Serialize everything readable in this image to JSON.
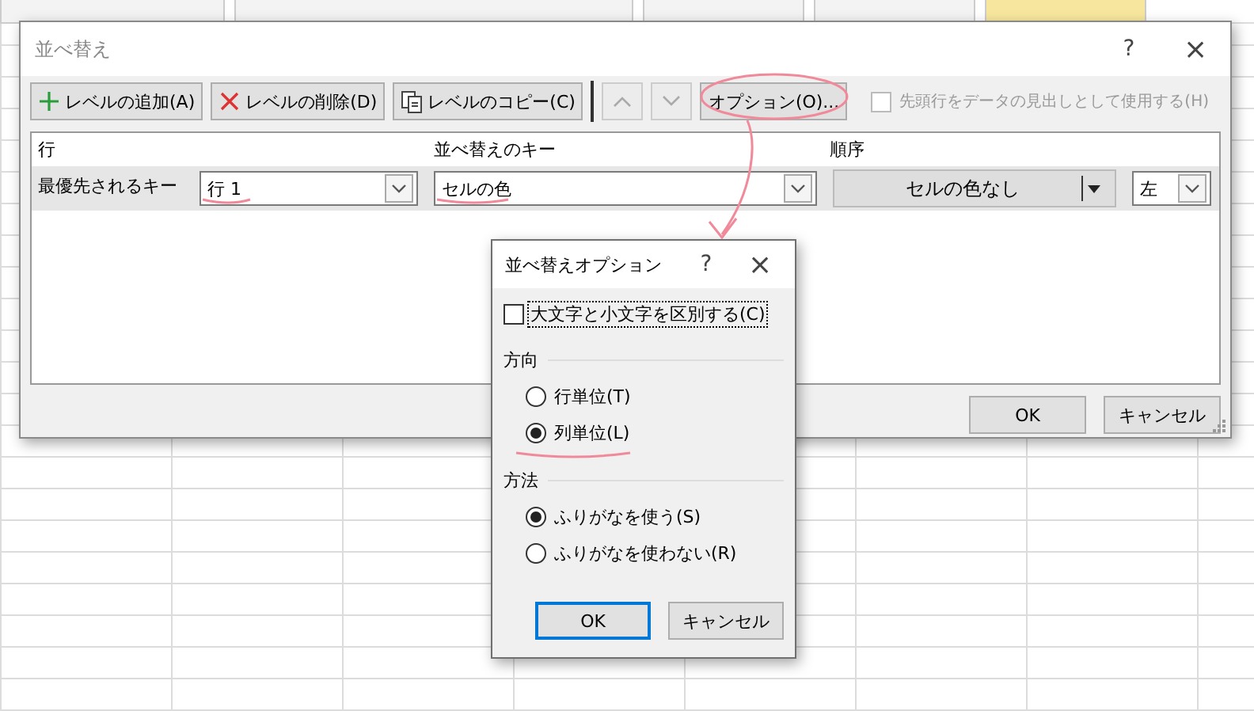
{
  "sort_dialog": {
    "title": "並べ替え",
    "help": "?",
    "close": "×",
    "toolbar": [
      {
        "kind": "add",
        "label": "レベルの追加(A)"
      },
      {
        "kind": "delete",
        "label": "レベルの削除(D)"
      },
      {
        "kind": "copy",
        "label": "レベルのコピー(C)"
      },
      {
        "kind": "up"
      },
      {
        "kind": "down"
      },
      {
        "kind": "options",
        "label": "オプション(O)..."
      }
    ],
    "header_checkbox": {
      "label": "先頭行をデータの見出しとして使用する(H)",
      "checked": false,
      "disabled": true
    },
    "columns": [
      "行",
      "並べ替えのキー",
      "順序"
    ],
    "rows": [
      {
        "label": "最優先されるキー",
        "row_field": "行 1",
        "sort_on": "セルの色",
        "order_color": "セルの色なし",
        "order_position": "左"
      }
    ],
    "buttons": [
      {
        "label": "OK",
        "default": false
      },
      {
        "label": "キャンセル",
        "default": false
      }
    ]
  },
  "options_dialog": {
    "title": "並べ替えオプション",
    "help": "?",
    "close": "×",
    "case_checkbox": {
      "label": "大文字と小文字を区別する(C)",
      "checked": false
    },
    "groups": [
      {
        "title": "方向",
        "options": [
          {
            "label": "行単位(T)",
            "selected": false
          },
          {
            "label": "列単位(L)",
            "selected": true
          }
        ]
      },
      {
        "title": "方法",
        "options": [
          {
            "label": "ふりがなを使う(S)",
            "selected": true
          },
          {
            "label": "ふりがなを使わない(R)",
            "selected": false
          }
        ]
      }
    ],
    "buttons": [
      {
        "label": "OK",
        "default": true
      },
      {
        "label": "キャンセル",
        "default": false
      }
    ]
  }
}
